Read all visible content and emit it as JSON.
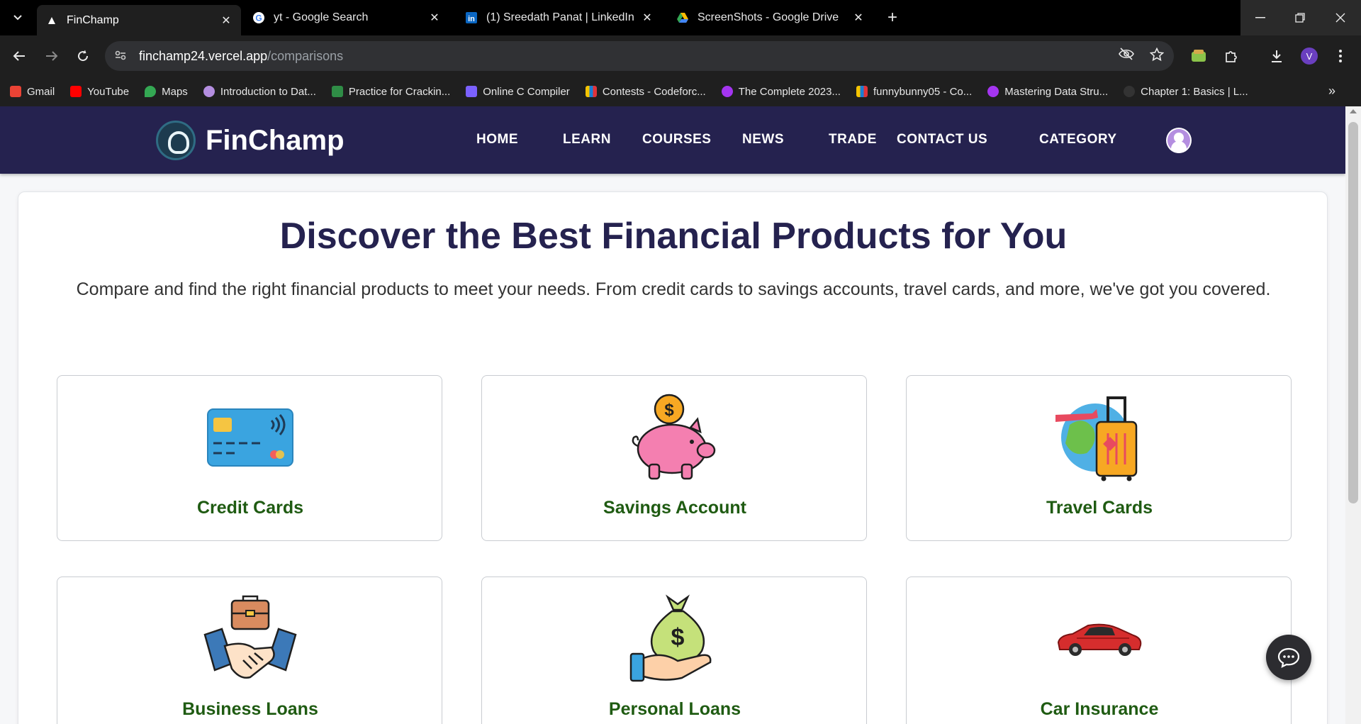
{
  "browser": {
    "tabs": [
      {
        "title": "FinChamp",
        "active": true,
        "favicon": "finchamp-icon"
      },
      {
        "title": "yt - Google Search",
        "active": false,
        "favicon": "google-icon"
      },
      {
        "title": "(1) Sreedath Panat | LinkedIn",
        "active": false,
        "favicon": "linkedin-icon"
      },
      {
        "title": "ScreenShots - Google Drive",
        "active": false,
        "favicon": "google-drive-icon"
      }
    ],
    "url_host": "finchamp24.vercel.app",
    "url_path": "/comparisons",
    "profile_initial": "V",
    "bookmarks": [
      {
        "label": "Gmail",
        "icon": "gmail-icon",
        "color": "#ea4335"
      },
      {
        "label": "YouTube",
        "icon": "youtube-icon",
        "color": "#ff0000"
      },
      {
        "label": "Maps",
        "icon": "maps-icon",
        "color": "#34a853"
      },
      {
        "label": "Introduction to Dat...",
        "icon": "course-icon",
        "color": "#b48ee0"
      },
      {
        "label": "Practice for Crackin...",
        "icon": "gfg-icon",
        "color": "#2f8d46"
      },
      {
        "label": "Online C Compiler",
        "icon": "compiler-icon",
        "color": "#7b61ff"
      },
      {
        "label": "Contests - Codeforc...",
        "icon": "codeforces-icon",
        "color": "#f5c400"
      },
      {
        "label": "The Complete 2023...",
        "icon": "udemy-icon",
        "color": "#a435f0"
      },
      {
        "label": "funnybunny05 - Co...",
        "icon": "codeforces-icon",
        "color": "#f5c400"
      },
      {
        "label": "Mastering Data Stru...",
        "icon": "udemy-icon",
        "color": "#a435f0"
      },
      {
        "label": "Chapter 1: Basics | L...",
        "icon": "book-icon",
        "color": "#333333"
      }
    ]
  },
  "site": {
    "brand": "FinChamp",
    "nav": [
      "HOME",
      "LEARN",
      "COURSES",
      "NEWS",
      "TRADE",
      "CONTACT US",
      "CATEGORY"
    ],
    "hero_title": "Discover the Best Financial Products for You",
    "hero_subtitle": "Compare and find the right financial products to meet your needs. From credit cards to savings accounts, travel cards, and more, we've got you covered.",
    "products": [
      {
        "label": "Credit Cards",
        "icon": "credit-card-icon"
      },
      {
        "label": "Savings Account",
        "icon": "piggy-bank-icon"
      },
      {
        "label": "Travel Cards",
        "icon": "travel-luggage-icon"
      },
      {
        "label": "Business Loans",
        "icon": "handshake-briefcase-icon"
      },
      {
        "label": "Personal Loans",
        "icon": "money-bag-hand-icon"
      },
      {
        "label": "Car Insurance",
        "icon": "car-icon"
      }
    ],
    "colors": {
      "nav_bg": "#25224f",
      "title": "#25224f",
      "product_label": "#1f5b12"
    }
  }
}
